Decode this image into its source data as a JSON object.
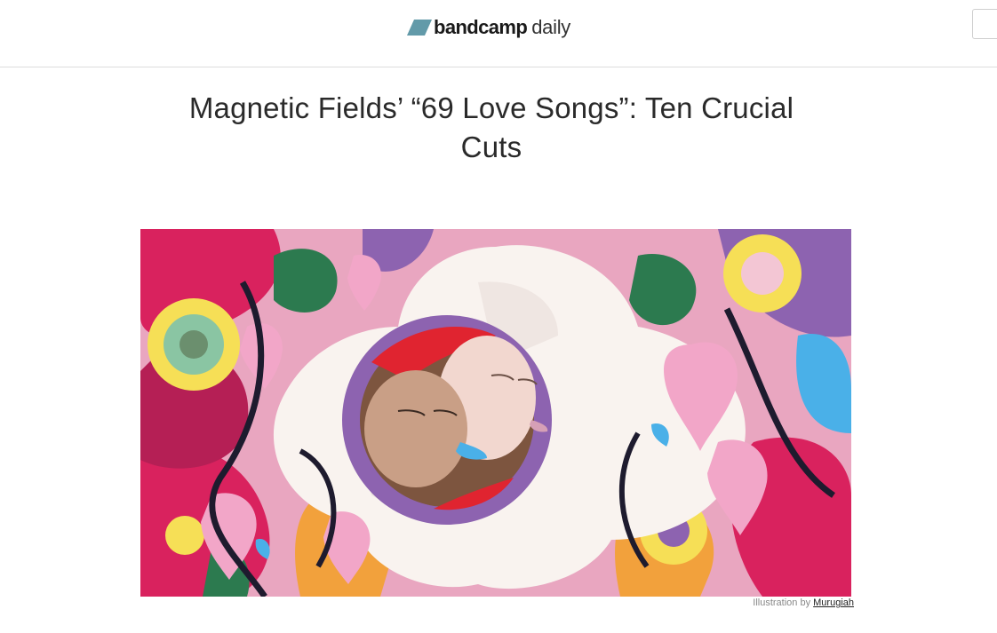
{
  "header": {
    "brand_name": "bandcamp",
    "brand_suffix": "daily",
    "brand_color": "#629aa9"
  },
  "article": {
    "title": "Magnetic Fields’ “69 Love Songs”: Ten Crucial Cuts",
    "image_caption_prefix": "Illustration by",
    "illustrator": "Murugiah"
  }
}
